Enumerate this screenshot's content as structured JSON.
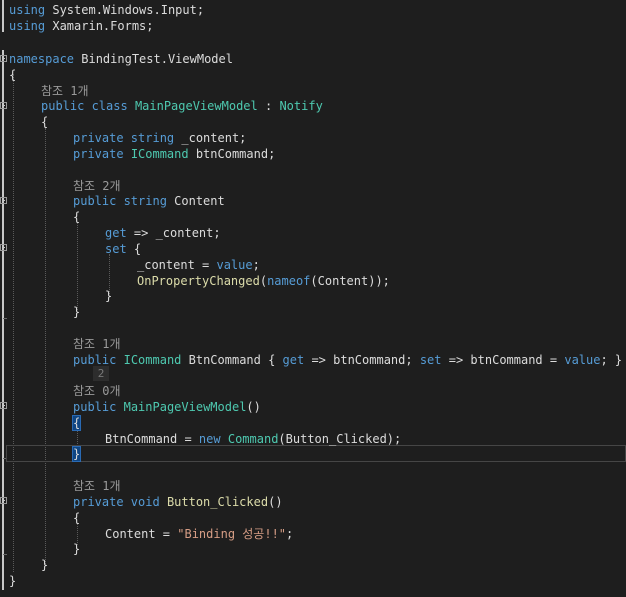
{
  "code_lines": [
    {
      "kw": "using",
      "rest": " System.Windows.Input;"
    },
    {
      "kw": "using",
      "rest": " Xamarin.Forms;"
    },
    {
      "kw": "namespace",
      "rest": " BindingTest.ViewModel"
    },
    {
      "text": "{"
    },
    {
      "ref": "참조 1개"
    },
    {
      "kw": "public class",
      "ty": "MainPageViewModel",
      "sep": " : ",
      "ty2": "Notify"
    },
    {
      "text": "{"
    },
    {
      "kw": "private string",
      "rest": " _content;"
    },
    {
      "kw": "private",
      "ty": "ICommand",
      "rest": " btnCommand;"
    },
    {
      "ref": "참조 2개"
    },
    {
      "kw": "public string",
      "rest": " Content"
    },
    {
      "text": "{"
    },
    {
      "kw": "get",
      "rest": " => _content;"
    },
    {
      "kw": "set",
      "rest": " {"
    },
    {
      "a": "_content = ",
      "kw": "value",
      "b": ";"
    },
    {
      "fn": "OnPropertyChanged",
      "a": "(",
      "kw": "nameof",
      "b": "(Content));"
    },
    {
      "text": "}"
    },
    {
      "text": "}"
    },
    {
      "ref": "참조 1개"
    },
    {
      "kw": "public",
      "ty": "ICommand",
      "a": " BtnCommand { ",
      "kw2": "get",
      "b": " => btnCommand; ",
      "kw3": "set",
      "c": " => btnCommand = ",
      "kw4": "value",
      "d": "; }"
    },
    {
      "badge": "2"
    },
    {
      "ref": "참조 0개"
    },
    {
      "kw": "public",
      "fn": "MainPageViewModel",
      "rest": "()"
    },
    {
      "text": "{"
    },
    {
      "a": "BtnCommand = ",
      "kw": "new",
      "ty": "Command",
      "b": "(Button_Clicked);"
    },
    {
      "text": "}"
    },
    {
      "ref": "참조 1개"
    },
    {
      "kw": "private void",
      "fn": "Button_Clicked",
      "rest": "()"
    },
    {
      "text": "{"
    },
    {
      "a": "Content = ",
      "str": "\"Binding 성공!!\"",
      "b": ";"
    },
    {
      "text": "}"
    },
    {
      "text": "}"
    },
    {
      "text": "}"
    }
  ],
  "colors": {
    "background": "#1e1e1e",
    "keyword": "#569cd6",
    "type": "#4ec9b0",
    "string": "#d69d85",
    "method": "#dcdcaa",
    "reference": "#9a9a9a",
    "text": "#dcdcdc"
  }
}
